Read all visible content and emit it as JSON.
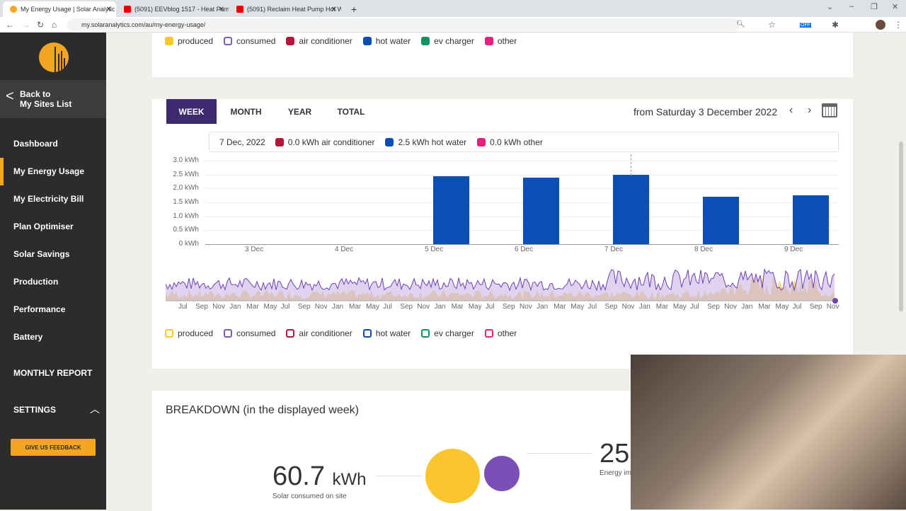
{
  "browser": {
    "tabs": [
      {
        "title": "My Energy Usage | Solar Analytic",
        "icon": "solar-icon"
      },
      {
        "title": "(5091) EEVblog 1517 - Heat Pum",
        "icon": "youtube-icon"
      },
      {
        "title": "(5091) Reclaim Heat Pump Hot W",
        "icon": "youtube-icon"
      }
    ],
    "url": "my.solaranalytics.com/au/my-energy-usage/",
    "new_tab": "+",
    "close": "✕",
    "extension_badge": "OFF"
  },
  "sidebar": {
    "back": [
      "Back to",
      "My Sites List"
    ],
    "items": [
      {
        "label": "Dashboard"
      },
      {
        "label": "My Energy Usage",
        "active": true
      },
      {
        "label": "My Electricity Bill"
      },
      {
        "label": "Plan Optimiser"
      },
      {
        "label": "Solar Savings"
      },
      {
        "label": "Production"
      },
      {
        "label": "Performance"
      },
      {
        "label": "Battery"
      }
    ],
    "monthly_report": "MONTHLY REPORT",
    "settings": "SETTINGS",
    "feedback": "GIVE US FEEDBACK"
  },
  "legend": [
    {
      "label": "produced",
      "color": "#f7c631"
    },
    {
      "label": "consumed",
      "color": "#7a5fb0"
    },
    {
      "label": "air conditioner",
      "color": "#b5163a"
    },
    {
      "label": "hot water",
      "color": "#0a4fb3"
    },
    {
      "label": "ev charger",
      "color": "#13935f"
    },
    {
      "label": "other",
      "color": "#ea1e7c"
    }
  ],
  "period_tabs": [
    {
      "label": "WEEK",
      "active": true
    },
    {
      "label": "MONTH"
    },
    {
      "label": "YEAR"
    },
    {
      "label": "TOTAL"
    }
  ],
  "date_range": "from Saturday 3 December 2022",
  "tooltip": {
    "date": "7 Dec, 2022",
    "items": [
      {
        "label": "0.0 kWh air conditioner",
        "color": "#b5163a"
      },
      {
        "label": "2.5 kWh hot water",
        "color": "#0a4fb3"
      },
      {
        "label": "0.0 kWh other",
        "color": "#ea1e7c"
      }
    ]
  },
  "chart_data": {
    "type": "bar",
    "categories": [
      "3 Dec",
      "4 Dec",
      "5 Dec",
      "6 Dec",
      "7 Dec",
      "8 Dec",
      "9 Dec"
    ],
    "series": [
      {
        "name": "hot water",
        "values": [
          0,
          0,
          2.45,
          2.4,
          2.5,
          1.7,
          1.75
        ],
        "color": "#0a4fb3"
      }
    ],
    "yticks": [
      "0 kWh",
      "0.5 kWh",
      "1.0 kWh",
      "1.5 kWh",
      "2.0 kWh",
      "2.5 kWh",
      "3.0 kWh"
    ],
    "ylim": [
      0,
      3
    ],
    "grid": true
  },
  "overview": {
    "months": [
      "Jul",
      "Sep",
      "Nov",
      "Jan",
      "Mar",
      "May",
      "Jul",
      "Sep",
      "Nov",
      "Jan",
      "Mar",
      "May",
      "Jul",
      "Sep",
      "Nov",
      "Jan",
      "Mar",
      "May",
      "Jul",
      "Sep",
      "Nov",
      "Jan",
      "Mar",
      "May",
      "Jul",
      "Sep",
      "Nov",
      "Jan",
      "Mar",
      "May",
      "Jul",
      "Sep",
      "Nov",
      "Jan",
      "Mar",
      "May",
      "Jul",
      "Sep",
      "Nov"
    ]
  },
  "breakdown": {
    "title": "BREAKDOWN (in the displayed week)",
    "solar_value": "60.7",
    "solar_unit": "kWh",
    "solar_label": "Solar consumed on site",
    "import_value": "25",
    "import_label": "Energy im"
  }
}
